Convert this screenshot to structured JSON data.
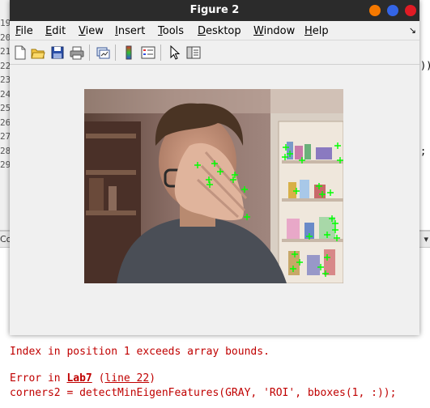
{
  "editor": {
    "line_numbers": [
      "19",
      "20",
      "21",
      "22",
      "23",
      "24",
      "25",
      "26",
      "27",
      "28",
      "29"
    ],
    "right_fragments": [
      "))",
      ";"
    ]
  },
  "command_window": {
    "header_label": "Co",
    "messages": {
      "index_error": "Index in position 1 exceeds array bounds.",
      "error_prefix": "Error in ",
      "error_function": "Lab7",
      "error_open_paren": " (",
      "error_line_link": "line 22",
      "error_close_paren": ")",
      "code_line": "corners2 = detectMinEigenFeatures(GRAY, 'ROI', bboxes(1, :));"
    }
  },
  "figure": {
    "title": "Figure 2",
    "menu": [
      {
        "mnemonic": "F",
        "rest": "ile"
      },
      {
        "mnemonic": "E",
        "rest": "dit"
      },
      {
        "mnemonic": "V",
        "rest": "iew"
      },
      {
        "mnemonic": "I",
        "rest": "nsert"
      },
      {
        "mnemonic": "T",
        "rest": "ools"
      },
      {
        "mnemonic": "D",
        "rest": "esktop"
      },
      {
        "mnemonic": "W",
        "rest": "indow"
      },
      {
        "mnemonic": "H",
        "rest": "elp"
      }
    ],
    "dock_arrow": "↘",
    "toolbar_icons": [
      "new-figure-icon",
      "open-file-icon",
      "save-icon",
      "print-icon",
      "link-plot-icon",
      "insert-colorbar-icon",
      "insert-legend-icon",
      "edit-plot-arrow-icon",
      "property-inspector-icon"
    ],
    "marker_color": "#00ff00",
    "window_button_colors": {
      "minimize": "#f57900",
      "maximize": "#3465e6",
      "close": "#e01b24"
    }
  }
}
